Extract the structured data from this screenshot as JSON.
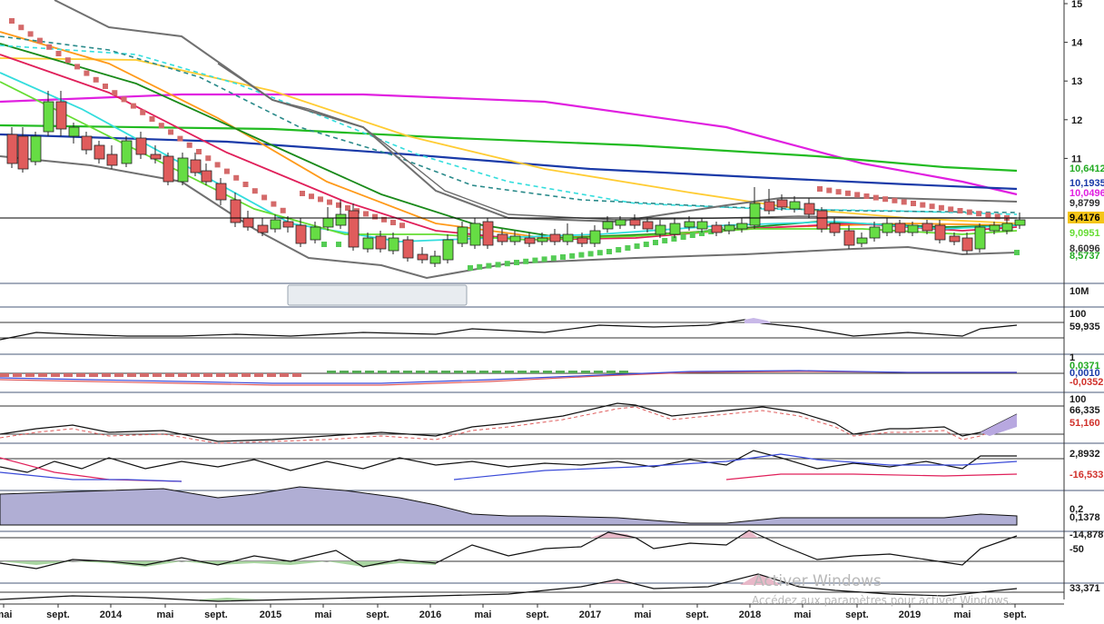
{
  "chart_data": {
    "type": "candlestick",
    "x_labels": [
      "mai",
      "sept.",
      "2014",
      "mai",
      "sept.",
      "2015",
      "mai",
      "sept.",
      "2016",
      "mai",
      "sept.",
      "2017",
      "mai",
      "sept.",
      "2018",
      "mai",
      "sept.",
      "2019",
      "mai",
      "sept."
    ],
    "price_axis_ticks": [
      "15",
      "14",
      "13",
      "12",
      "11"
    ],
    "price_axis_range": [
      8.0,
      15.0
    ],
    "value_tags": [
      {
        "text": "10,6412",
        "color": "#22aa22"
      },
      {
        "text": "10,1935",
        "color": "#1a3aa8"
      },
      {
        "text": "10,0496",
        "color": "#e020e0"
      },
      {
        "text": "9,8799",
        "color": "#333333"
      },
      {
        "text": "9,4176",
        "color": "#000000",
        "bg": "#f5c518"
      },
      {
        "text": "9,0951",
        "color": "#66dd33"
      },
      {
        "text": "8,6096",
        "color": "#333333"
      },
      {
        "text": "8,5737",
        "color": "#22aa22"
      }
    ],
    "volume_label": "10M",
    "panels": [
      {
        "name": "panel-1",
        "top_tick": "100",
        "value": "59,935"
      },
      {
        "name": "panel-2",
        "top_tick": "1",
        "values": [
          "0,0371",
          "0,0010",
          "-0,0352"
        ]
      },
      {
        "name": "panel-3",
        "top_tick": "100",
        "values": [
          "66,335",
          "51,160"
        ]
      },
      {
        "name": "panel-4",
        "values": [
          "2,8932",
          "-16,533"
        ]
      },
      {
        "name": "panel-5",
        "top_tick": "0,2",
        "value": "0,1378"
      },
      {
        "name": "panel-6",
        "tick": "-50",
        "value": "-14,878"
      },
      {
        "name": "panel-7",
        "value": "33,371"
      }
    ],
    "colors": {
      "up_candle": "#66dd44",
      "down_candle": "#e05c5c",
      "ma_green": "#22bb22",
      "ma_blue": "#1a3aa8",
      "ma_magenta": "#e020e0",
      "ma_orange": "#ff9a1a",
      "ma_yellow": "#ffcc33",
      "ma_red": "#e0205a",
      "ma_cyan": "#33dddd",
      "ma_lime": "#66dd33",
      "bollinger": "#707070",
      "sar_up": "#55cc55",
      "sar_down": "#d46a6a"
    }
  },
  "watermark": {
    "title": "Activer Windows",
    "subtitle": "Accédez aux paramètres pour activer Windows."
  }
}
